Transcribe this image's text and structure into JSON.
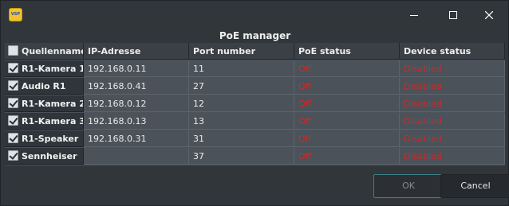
{
  "window": {
    "app_icon_text": "VSP",
    "caption": "PoE manager"
  },
  "columns": [
    "Quellenname",
    "IP-Adresse",
    "Port number",
    "PoE status",
    "Device status"
  ],
  "rows": [
    {
      "name": "R1-Kamera 1",
      "ip": "192.168.0.11",
      "port": "11",
      "poe": "Off",
      "device": "Disabled",
      "checked": true
    },
    {
      "name": "Audio R1",
      "ip": "192.168.0.41",
      "port": "27",
      "poe": "Off",
      "device": "Disabled",
      "checked": true
    },
    {
      "name": "R1-Kamera 2",
      "ip": "192.168.0.12",
      "port": "12",
      "poe": "Off",
      "device": "Disabled",
      "checked": true
    },
    {
      "name": "R1-Kamera 3",
      "ip": "192.168.0.13",
      "port": "13",
      "poe": "Off",
      "device": "Disabled",
      "checked": true
    },
    {
      "name": "R1-Speaker",
      "ip": "192.168.0.31",
      "port": "31",
      "poe": "Off",
      "device": "Disabled",
      "checked": true
    },
    {
      "name": "Sennheiser",
      "ip": "",
      "port": "37",
      "poe": "Off",
      "device": "Disabled",
      "checked": true
    }
  ],
  "buttons": {
    "ok": "OK",
    "cancel": "Cancel"
  },
  "colors": {
    "status_off": "#cc2a2a",
    "background": "#31363b"
  }
}
